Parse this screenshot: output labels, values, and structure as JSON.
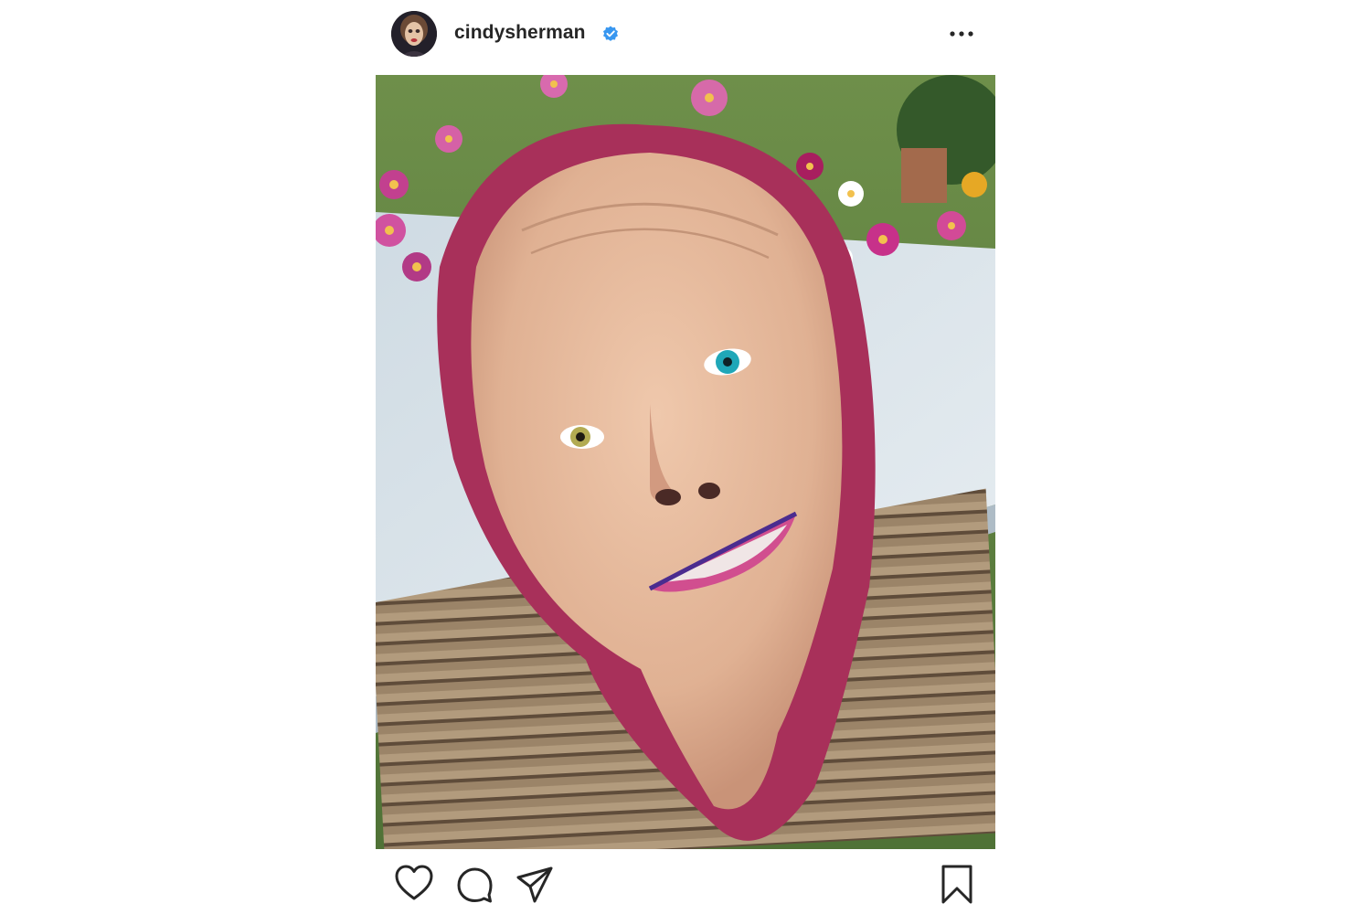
{
  "post": {
    "username": "cindysherman",
    "verified": true,
    "avatar_icon": "profile-avatar",
    "more_icon": "more-options-icon"
  },
  "photo": {
    "subject": "edited-selfie-photo"
  },
  "actions": {
    "like_icon": "heart-icon",
    "comment_icon": "comment-icon",
    "share_icon": "paper-plane-icon",
    "save_icon": "bookmark-icon"
  },
  "colors": {
    "text": "#262626",
    "verified_badge": "#3897f0",
    "icon": "#262626",
    "background": "#ffffff"
  }
}
